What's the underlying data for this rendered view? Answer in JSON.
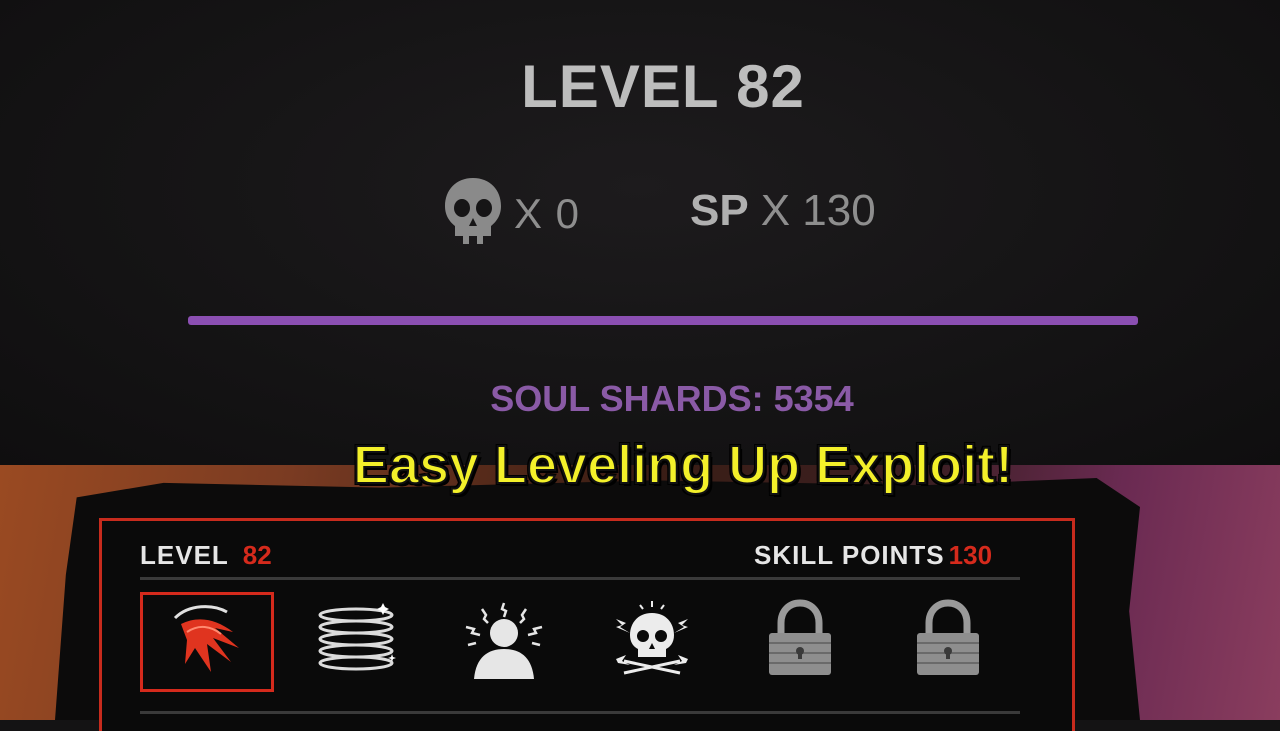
{
  "top_screen": {
    "level_title": "LEVEL 82",
    "skull_icon": "skull-icon",
    "skull_count": "X 0",
    "sp_label": "SP",
    "sp_value": "X 130",
    "xp_progress_percent": 100,
    "xp_bar_color": "#8b4fb2",
    "soul_shards": "SOUL SHARDS: 5354"
  },
  "caption": {
    "text": "Easy Leveling Up Exploit!",
    "color": "#f3f02a"
  },
  "hud": {
    "level_label": "LEVEL",
    "level_value": "82",
    "skill_label": "SKILL POINTS",
    "skill_value": "130",
    "accent_color": "#d52a1c",
    "abilities": [
      {
        "icon": "red-claw-slash-icon",
        "selected": true
      },
      {
        "icon": "spring-coil-icon",
        "selected": false
      },
      {
        "icon": "shocked-person-icon",
        "selected": false
      },
      {
        "icon": "skull-lightning-icon",
        "selected": false
      },
      {
        "icon": "padlock-icon",
        "selected": false,
        "locked": true
      },
      {
        "icon": "padlock-icon",
        "selected": false,
        "locked": true
      }
    ]
  }
}
